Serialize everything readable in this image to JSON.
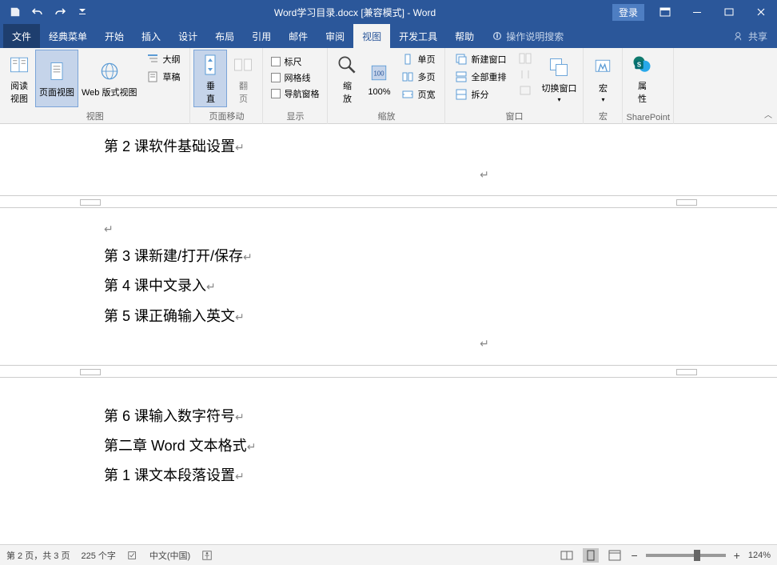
{
  "title": "Word学习目录.docx [兼容模式] - Word",
  "login": "登录",
  "menu": {
    "file": "文件",
    "classic": "经典菜单",
    "home": "开始",
    "insert": "插入",
    "design": "设计",
    "layout": "布局",
    "references": "引用",
    "mail": "邮件",
    "review": "审阅",
    "view": "视图",
    "dev": "开发工具",
    "help": "帮助",
    "tellme": "操作说明搜索",
    "share": "共享"
  },
  "ribbon": {
    "views": {
      "read": "阅读\n视图",
      "print": "页面视图",
      "web": "Web 版式视图",
      "outline": "大纲",
      "draft": "草稿",
      "group": "视图"
    },
    "pagemove": {
      "vertical": "垂\n直",
      "flip": "翻\n页",
      "group": "页面移动"
    },
    "show": {
      "ruler": "标尺",
      "gridlines": "网格线",
      "navpane": "导航窗格",
      "group": "显示"
    },
    "zoom": {
      "zoom": "缩\n放",
      "hundred": "100%",
      "one": "单页",
      "multi": "多页",
      "width": "页宽",
      "group": "缩放"
    },
    "window": {
      "neww": "新建窗口",
      "all": "全部重排",
      "split": "拆分",
      "switch": "切换窗口",
      "group": "窗口"
    },
    "macro": {
      "macro": "宏",
      "group": "宏"
    },
    "sp": {
      "prop": "属\n性",
      "group": "SharePoint"
    }
  },
  "doc": {
    "l1": "第 2 课软件基础设置",
    "l2": "第 3 课新建/打开/保存",
    "l3": "第 4 课中文录入",
    "l4": "第 5 课正确输入英文",
    "l5": "第 6 课输入数字符号",
    "l6": "第二章 Word 文本格式",
    "l7": "第 1 课文本段落设置"
  },
  "status": {
    "page": "第 2 页，共 3 页",
    "words": "225 个字",
    "lang": "中文(中国)",
    "zoom": "124%"
  }
}
